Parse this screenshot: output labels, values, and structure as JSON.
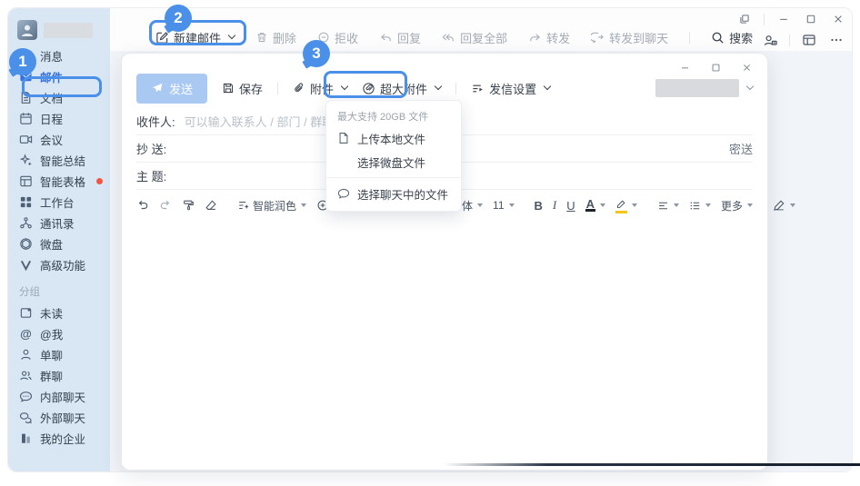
{
  "sidebar": {
    "items": [
      {
        "label": "消息"
      },
      {
        "label": "邮件"
      },
      {
        "label": "文档"
      },
      {
        "label": "日程"
      },
      {
        "label": "会议"
      },
      {
        "label": "智能总结"
      },
      {
        "label": "智能表格"
      },
      {
        "label": "工作台"
      },
      {
        "label": "通讯录"
      },
      {
        "label": "微盘"
      },
      {
        "label": "高级功能"
      }
    ],
    "section_label": "分组",
    "group_items": [
      {
        "label": "未读"
      },
      {
        "label": "@我"
      },
      {
        "label": "单聊"
      },
      {
        "label": "群聊"
      },
      {
        "label": "内部聊天"
      },
      {
        "label": "外部聊天"
      },
      {
        "label": "我的企业"
      }
    ]
  },
  "toolbar": {
    "new_mail": "新建邮件",
    "delete": "删除",
    "reject": "拒收",
    "reply": "回复",
    "reply_all": "回复全部",
    "forward": "转发",
    "forward_chat": "转发到聊天",
    "search": "搜索"
  },
  "compose": {
    "send": "发送",
    "save": "保存",
    "attachment": "附件",
    "large_attachment": "超大附件",
    "send_settings": "发信设置",
    "to_label": "收件人:",
    "to_placeholder": "可以输入联系人 / 部门 / 群聊",
    "cc_label": "抄 送:",
    "bcc_label": "密送",
    "subject_label": "主 题:",
    "format": {
      "smart_polish": "智能润色",
      "insert": "插入",
      "default_font": "默认字体",
      "font_size": "11",
      "bold": "B",
      "italic": "I",
      "underline": "U",
      "color_letter": "A",
      "more": "更多"
    }
  },
  "dropdown": {
    "hint": "最大支持 20GB 文件",
    "upload_local": "上传本地文件",
    "select_drive": "选择微盘文件",
    "select_chat": "选择聊天中的文件"
  },
  "annotations": {
    "step1": "1",
    "step2": "2",
    "step3": "3"
  },
  "colors": {
    "accent": "#4a8fe8",
    "sidebar_bg": "#d9e6f4",
    "selected_blue": "#3370de",
    "badge_red": "#f25643",
    "send_button_bg": "#a9c9f2",
    "workspace_bg": "#f1f4f8"
  }
}
